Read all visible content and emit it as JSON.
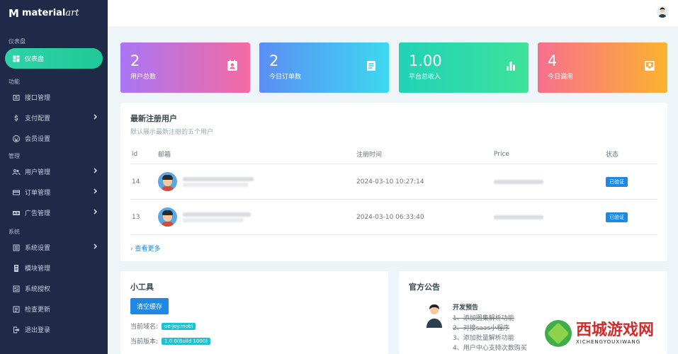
{
  "logo": {
    "mark": "M",
    "text": "material",
    "suffix": "art"
  },
  "sidebar": {
    "sections": [
      {
        "title": "仪表盘",
        "items": [
          {
            "label": "仪表盘",
            "icon": "dashboard-icon",
            "active": true
          }
        ]
      },
      {
        "title": "功能",
        "items": [
          {
            "label": "接口管理",
            "icon": "api-icon"
          },
          {
            "label": "支付配置",
            "icon": "dollar-icon"
          },
          {
            "label": "会员设置",
            "icon": "smile-icon"
          }
        ]
      },
      {
        "title": "管理",
        "items": [
          {
            "label": "用户管理",
            "icon": "users-icon"
          },
          {
            "label": "订单管理",
            "icon": "card-icon"
          },
          {
            "label": "广告管理",
            "icon": "ad-icon"
          }
        ]
      },
      {
        "title": "系统",
        "items": [
          {
            "label": "系统设置",
            "icon": "list-icon"
          },
          {
            "label": "模块管理",
            "icon": "module-icon"
          },
          {
            "label": "系统授权",
            "icon": "license-icon"
          },
          {
            "label": "检查更新",
            "icon": "update-icon"
          },
          {
            "label": "退出登录",
            "icon": "logout-icon"
          }
        ]
      }
    ]
  },
  "stats": [
    {
      "value": "2",
      "label": "用户总数",
      "icon": "contact-icon"
    },
    {
      "value": "2",
      "label": "今日订单数",
      "icon": "doc-icon"
    },
    {
      "value": "1.00",
      "label": "平台总收入",
      "icon": "bar-chart-icon"
    },
    {
      "value": "4",
      "label": "今日调用",
      "icon": "inbox-icon"
    }
  ],
  "users_panel": {
    "title": "最新注册用户",
    "subtitle": "默认展示最新注册的五个用户",
    "columns": [
      "id",
      "邮箱",
      "注册时间",
      "Price",
      "状态"
    ],
    "rows": [
      {
        "id": "14",
        "time": "2024-03-10 10:27:14",
        "status": "已验证"
      },
      {
        "id": "13",
        "time": "2024-03-10 06:33:40",
        "status": "已验证"
      }
    ],
    "more": "查看更多"
  },
  "tools_panel": {
    "title": "小工具",
    "clear_button": "清空缓存",
    "domain_label": "当前域名:",
    "domain_value": "oe-joy.mobi",
    "version_label": "当前版本:",
    "version_value": "1.0.0(Build 1000)"
  },
  "news_panel": {
    "title": "官方公告",
    "heading": "开发预告",
    "items": [
      {
        "text": "1、添加图集解析功能",
        "struck": true
      },
      {
        "text": "2、对接saas小程序",
        "struck": true
      },
      {
        "text": "3、添加批量解析功能",
        "struck": false
      },
      {
        "text": "4、用户中心支持次数购买",
        "struck": false
      }
    ]
  },
  "brand": {
    "name": "西城游戏网",
    "sub": "XICHENGYOUXIWANG"
  },
  "colors": {
    "sidebar": "#1e2a47",
    "active": "#20c997",
    "badge": "#1e88e5"
  }
}
